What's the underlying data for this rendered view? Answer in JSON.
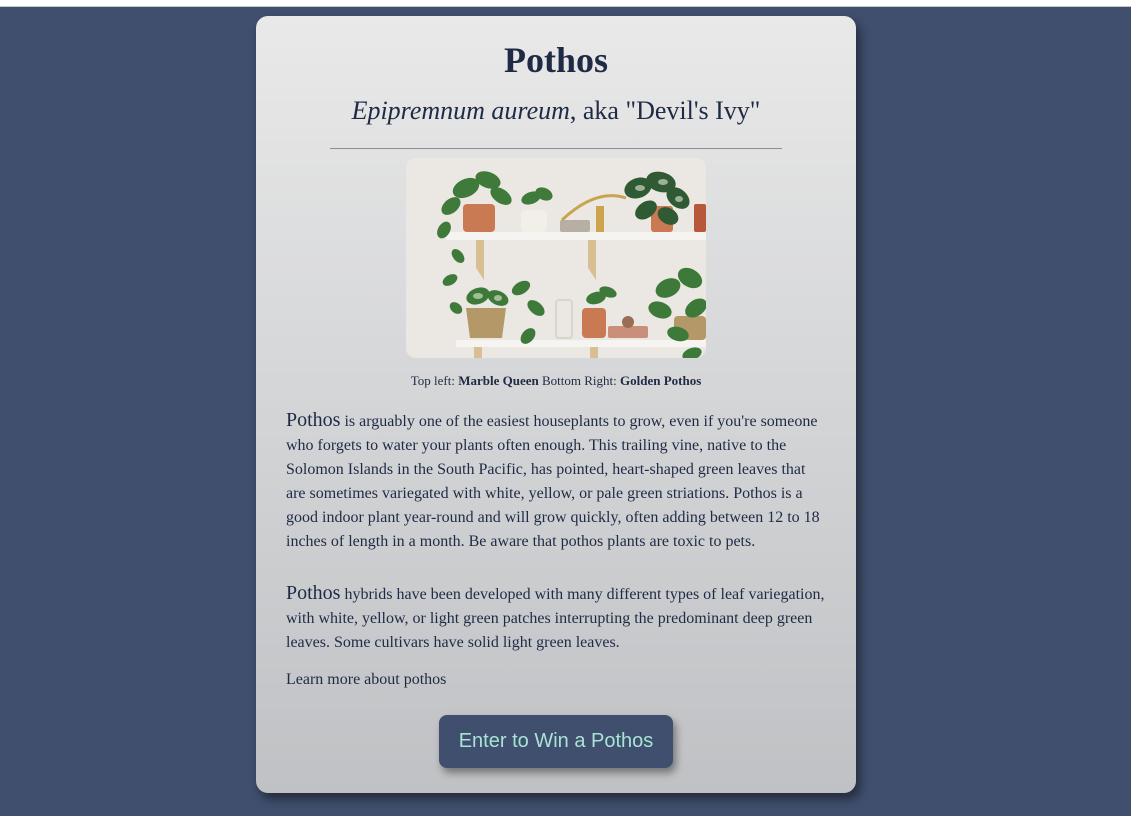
{
  "page": {
    "title": "Pothos",
    "subtitle_species": "Epipremnum aureum",
    "subtitle_rest": ", aka \"Devil's Ivy\""
  },
  "image": {
    "alt": "Pothos plants on shelves"
  },
  "caption": {
    "prefix1": "Top left: ",
    "name1": "Marble Queen",
    "prefix2": " Bottom Right: ",
    "name2": "Golden Pothos"
  },
  "paragraphs": [
    {
      "lead": "Pothos",
      "text": " is arguably one of the easiest houseplants to grow, even if you're someone who forgets to water your plants often enough. This trailing vine, native to the Solomon Islands in the South Pacific, has pointed, heart-shaped green leaves that are sometimes variegated with white, yellow, or pale green striations. Pothos is a good indoor plant year-round and will grow quickly, often adding between 12 to 18 inches of length in a month. Be aware that pothos plants are toxic to pets."
    },
    {
      "lead": "Pothos",
      "text": " hybrids have been developed with many different types of leaf variegation, with white, yellow, or light green patches interrupting the predominant deep green leaves. Some cultivars have solid light green leaves."
    }
  ],
  "learn_more": "Learn more about pothos",
  "cta_label": "Enter to Win a Pothos",
  "colors": {
    "background": "#3f4f6d",
    "button_text": "#a9e3d6",
    "text": "#1f2a44"
  }
}
